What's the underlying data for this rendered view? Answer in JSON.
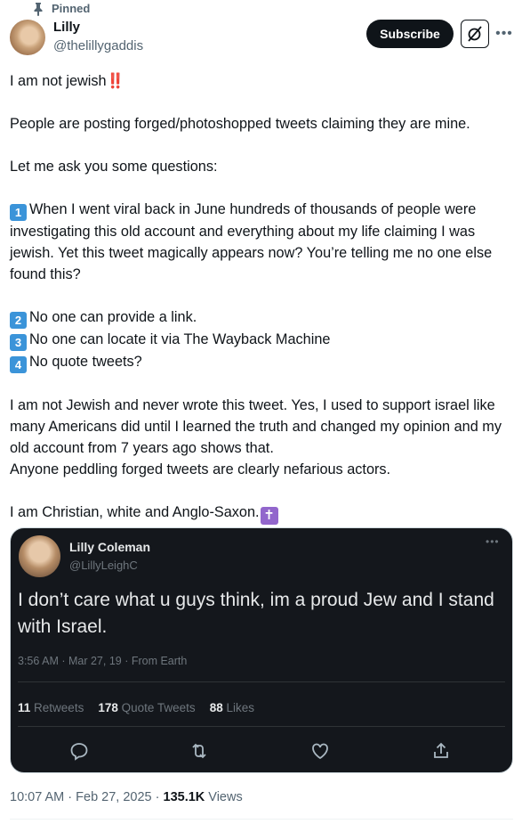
{
  "pinned_label": "Pinned",
  "author": {
    "name": "Lilly",
    "handle": "@thelillygaddis"
  },
  "actions": {
    "subscribe_label": "Subscribe",
    "grok_icon": "grok-slash-icon",
    "more_icon": "more-dots-icon"
  },
  "tweet": {
    "l1": "I am not jewish",
    "l1_emoji": "‼️",
    "p2": "People are posting forged/photoshopped tweets claiming they are mine.",
    "p3": "Let me ask you some questions:",
    "q1_num": "1",
    "q1": "When I went viral back in June hundreds of thousands of people were investigating this old account and everything about my life claiming I was jewish. Yet this tweet magically appears now? You’re telling me no one else found this?",
    "q2_num": "2",
    "q2": "No one can provide a link.",
    "q3_num": "3",
    "q3": "No one can locate it via The Wayback Machine",
    "q4_num": "4",
    "q4": "No quote tweets?",
    "p5": "I am not Jewish and never wrote this tweet. Yes, I used to support israel like many Americans did until I learned the truth and changed my opinion and my old account from 7 years ago shows that.",
    "p6": "Anyone peddling forged tweets are clearly nefarious actors.",
    "p7": "I am Christian, white and Anglo-Saxon.",
    "p7_emoji": "✝"
  },
  "media": {
    "name": "Lilly Coleman",
    "handle": "@LillyLeighC",
    "text": "I don’t care what u guys think, im a proud Jew and I stand with Israel.",
    "meta": "3:56 AM · Mar 27, 19 · From Earth",
    "retweets_count": "11",
    "retweets_label": "Retweets",
    "quotes_count": "178",
    "quotes_label": "Quote Tweets",
    "likes_count": "88",
    "likes_label": "Likes"
  },
  "footer": {
    "time": "10:07 AM · Feb 27, 2025 · ",
    "views_count": "135.1K",
    "views_label": " Views"
  }
}
